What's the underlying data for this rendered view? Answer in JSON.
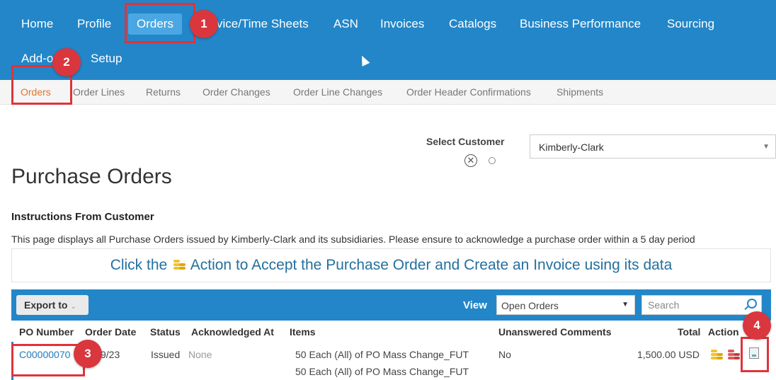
{
  "topnav": {
    "items": [
      "Home",
      "Profile",
      "Orders",
      "vice/Time Sheets",
      "ASN",
      "Invoices",
      "Catalogs",
      "Business Performance",
      "Sourcing",
      "Add-o",
      "Setup"
    ]
  },
  "subnav": {
    "items": [
      "Orders",
      "Order Lines",
      "Returns",
      "Order Changes",
      "Order Line Changes",
      "Order Header Confirmations",
      "Shipments"
    ]
  },
  "callouts": [
    "1",
    "2",
    "3",
    "4"
  ],
  "customer": {
    "label": "Select Customer",
    "value": "Kimberly-Clark"
  },
  "page": {
    "title": "Purchase Orders",
    "instructions_title": "Instructions From Customer",
    "instructions_text": "This page displays all Purchase Orders issued by Kimberly-Clark and its subsidiaries. Please ensure to acknowledge a purchase order within a 5 day period"
  },
  "banner": {
    "before": "Click the",
    "after": "Action to Accept the Purchase Order and Create an Invoice using its data"
  },
  "toolbar": {
    "export_label": "Export to",
    "view_label": "View",
    "view_value": "Open Orders",
    "search_placeholder": "Search"
  },
  "table": {
    "headers": [
      "PO Number",
      "Order Date",
      "Status",
      "Acknowledged At",
      "Items",
      "Unanswered Comments",
      "Total",
      "Action"
    ],
    "rows": [
      {
        "po_number": "C00000070",
        "order_date": "9/23",
        "status": "Issued",
        "acknowledged_at": "None",
        "items": [
          "50 Each (All) of PO Mass Change_FUT",
          "50 Each (All) of PO Mass Change_FUT"
        ],
        "unanswered_comments": "No",
        "total": "1,500.00 USD"
      }
    ]
  },
  "colors": {
    "nav_blue": "#2386c8",
    "active_tab": "#4aa7e3",
    "sub_active": "#e8722c",
    "callout_red": "#d9363e",
    "link": "#1f7bbd"
  }
}
